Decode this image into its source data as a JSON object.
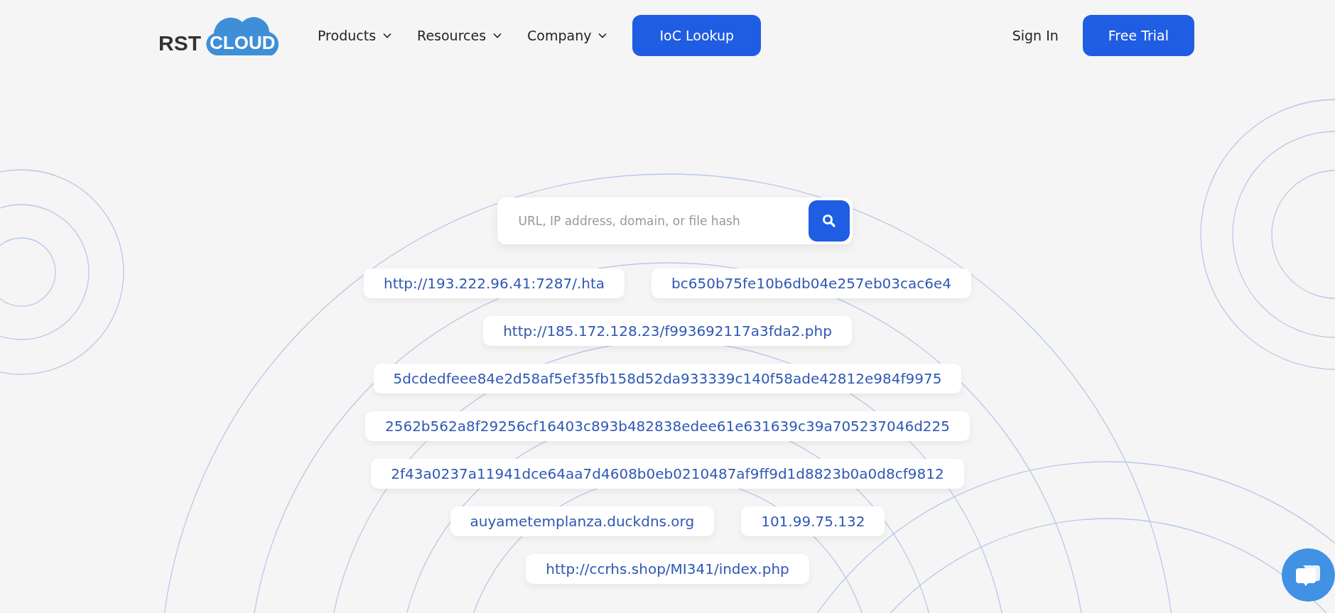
{
  "header": {
    "logo": {
      "left": "RST",
      "right": "CLOUD"
    },
    "nav": [
      {
        "label": "Products",
        "dropdown": true
      },
      {
        "label": "Resources",
        "dropdown": true
      },
      {
        "label": "Company",
        "dropdown": true
      }
    ],
    "primary_link": "IoC Lookup",
    "sign_in": "Sign In",
    "cta": "Free Trial"
  },
  "search": {
    "placeholder": "URL, IP address, domain, or file hash"
  },
  "example_rows": [
    {
      "items": [
        "http://193.222.96.41:7287/.hta",
        "bc650b75fe10b6db04e257eb03cac6e4"
      ]
    },
    {
      "items": [
        "http://185.172.128.23/f993692117a3fda2.php"
      ]
    },
    {
      "items": [
        "5dcdedfeee84e2d58af5ef35fb158d52da933339c140f58ade42812e984f9975"
      ]
    },
    {
      "items": [
        "2562b562a8f29256cf16403c893b482838edee61e631639c39a705237046d225"
      ]
    },
    {
      "items": [
        "2f43a0237a11941dce64aa7d4608b0eb0210487af9ff9d1d8823b0a0d8cf9812"
      ]
    },
    {
      "items": [
        "auyametemplanza.duckdns.org",
        "101.99.75.132"
      ]
    },
    {
      "items": [
        "http://ccrhs.shop/MI341/index.php"
      ]
    }
  ]
}
